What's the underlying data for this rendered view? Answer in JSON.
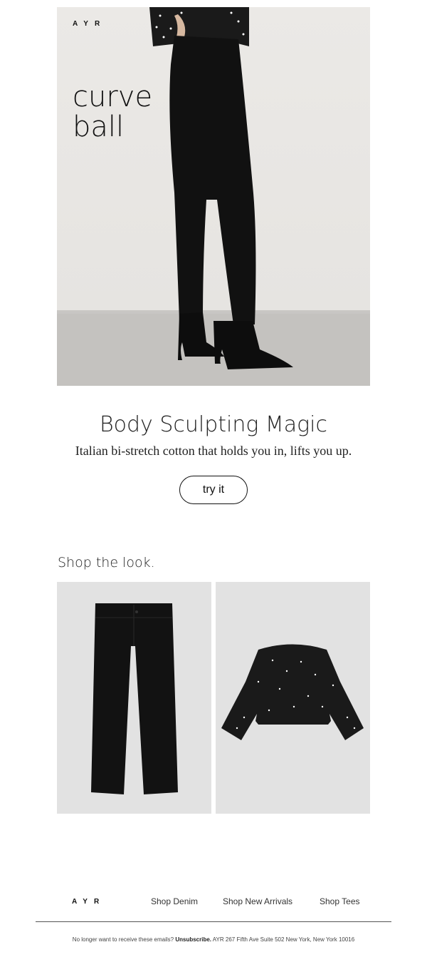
{
  "hero": {
    "brand": "AYR",
    "tagline_line1": "curve",
    "tagline_line2": "ball"
  },
  "promo": {
    "headline": "Body Sculpting Magic",
    "subline": "Italian bi-stretch cotton that holds you in, lifts you up.",
    "cta_label": "try it"
  },
  "shop": {
    "title": "Shop the look.",
    "products": [
      {
        "name": "pants"
      },
      {
        "name": "top"
      }
    ]
  },
  "footer": {
    "brand": "AYR",
    "links": [
      "Shop Denim",
      "Shop New Arrivals",
      "Shop Tees"
    ],
    "legal_prefix": "No longer want to receive these emails?",
    "unsubscribe": "Unsubscribe.",
    "address": "AYR 267 Fifth Ave Suite 502 New York, New York 10016"
  },
  "colors": {
    "text": "#111111",
    "background": "#ffffff",
    "product_bg": "#e2e2e2"
  }
}
